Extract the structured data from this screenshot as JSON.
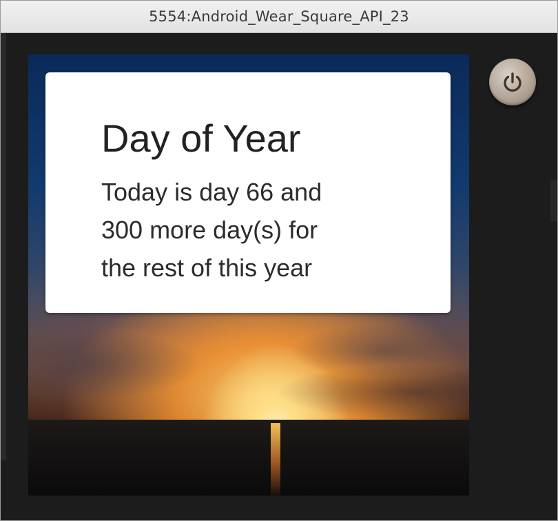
{
  "window": {
    "title": "5554:Android_Wear_Square_API_23"
  },
  "card": {
    "title": "Day of Year",
    "lines": [
      "Today is day 66 and",
      "300 more day(s) for",
      "the rest of this year"
    ]
  },
  "controls": {
    "power_icon": "power-icon"
  },
  "colors": {
    "card_background": "#ffffff",
    "card_text": "#222222",
    "emulator_frame": "#1c1c1c",
    "power_button": "#b3a597"
  }
}
